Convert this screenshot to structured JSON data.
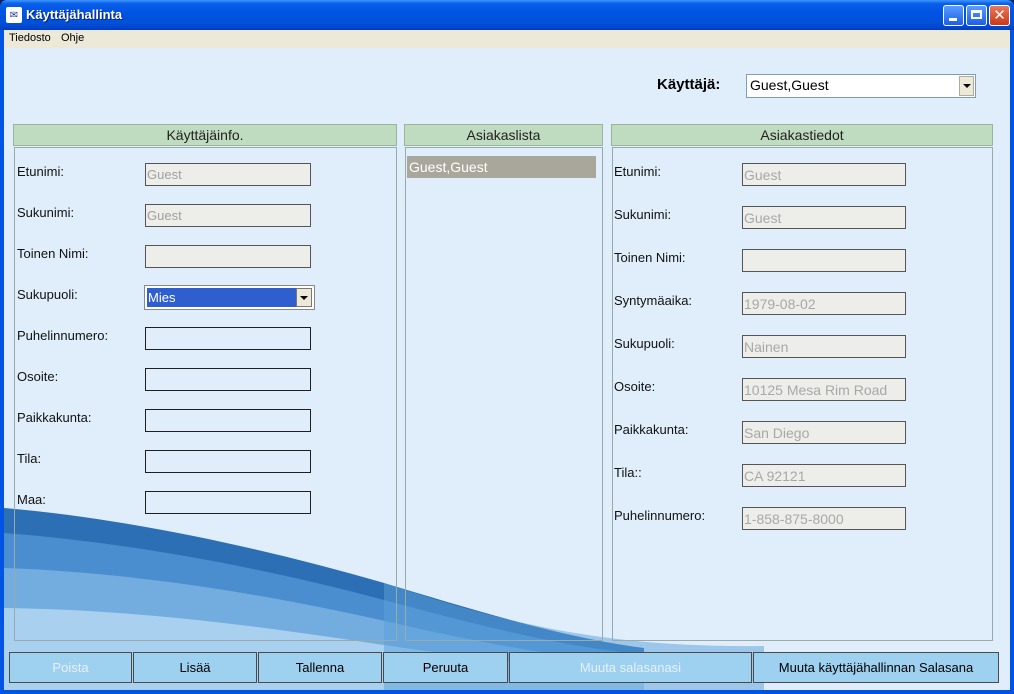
{
  "window": {
    "title": "Käyttäjähallinta",
    "app_icon": "app-icon"
  },
  "menu": {
    "items": [
      "Tiedosto",
      "Ohje"
    ]
  },
  "user_select": {
    "label": "Käyttäjä:",
    "value": "Guest,Guest"
  },
  "user_info": {
    "header": "Käyttäjäinfo.",
    "fields": [
      {
        "label": "Etunimi:",
        "value": "Guest",
        "readonly": true
      },
      {
        "label": "Sukunimi:",
        "value": "Guest",
        "readonly": true
      },
      {
        "label": "Toinen Nimi:",
        "value": "",
        "readonly": true
      },
      {
        "label": "Sukupuoli:",
        "value": "Mies",
        "type": "select"
      },
      {
        "label": "Puhelinnumero:",
        "value": ""
      },
      {
        "label": "Osoite:",
        "value": ""
      },
      {
        "label": "Paikkakunta:",
        "value": ""
      },
      {
        "label": "Tila:",
        "value": ""
      },
      {
        "label": "Maa:",
        "value": ""
      }
    ]
  },
  "customer_list": {
    "header": "Asiakaslista",
    "items": [
      "Guest,Guest"
    ],
    "selected": 0
  },
  "customer_details": {
    "header": "Asiakastiedot",
    "fields": [
      {
        "label": "Etunimi:",
        "value": "Guest"
      },
      {
        "label": "Sukunimi:",
        "value": "Guest"
      },
      {
        "label": "Toinen Nimi:",
        "value": ""
      },
      {
        "label": "Syntymäaika:",
        "value": "1979-08-02"
      },
      {
        "label": "Sukupuoli:",
        "value": "Nainen"
      },
      {
        "label": "Osoite:",
        "value": "10125 Mesa Rim Road"
      },
      {
        "label": "Paikkakunta:",
        "value": "San Diego"
      },
      {
        "label": "Tila::",
        "value": "CA 92121"
      },
      {
        "label": "Puhelinnumero:",
        "value": "1-858-875-8000"
      }
    ]
  },
  "buttons": {
    "delete": "Poista",
    "add": "Lisää",
    "save": "Tallenna",
    "cancel": "Peruuta",
    "change_password": "Muuta salasanasi",
    "change_admin_password": "Muuta käyttäjähallinnan Salasana"
  },
  "colors": {
    "title_bar": "#0054e3",
    "client_bg": "#dfeefa",
    "panel_header": "#c0dcc0",
    "button_bg": "#9ed0ef",
    "selection": "#2f5fcf"
  }
}
